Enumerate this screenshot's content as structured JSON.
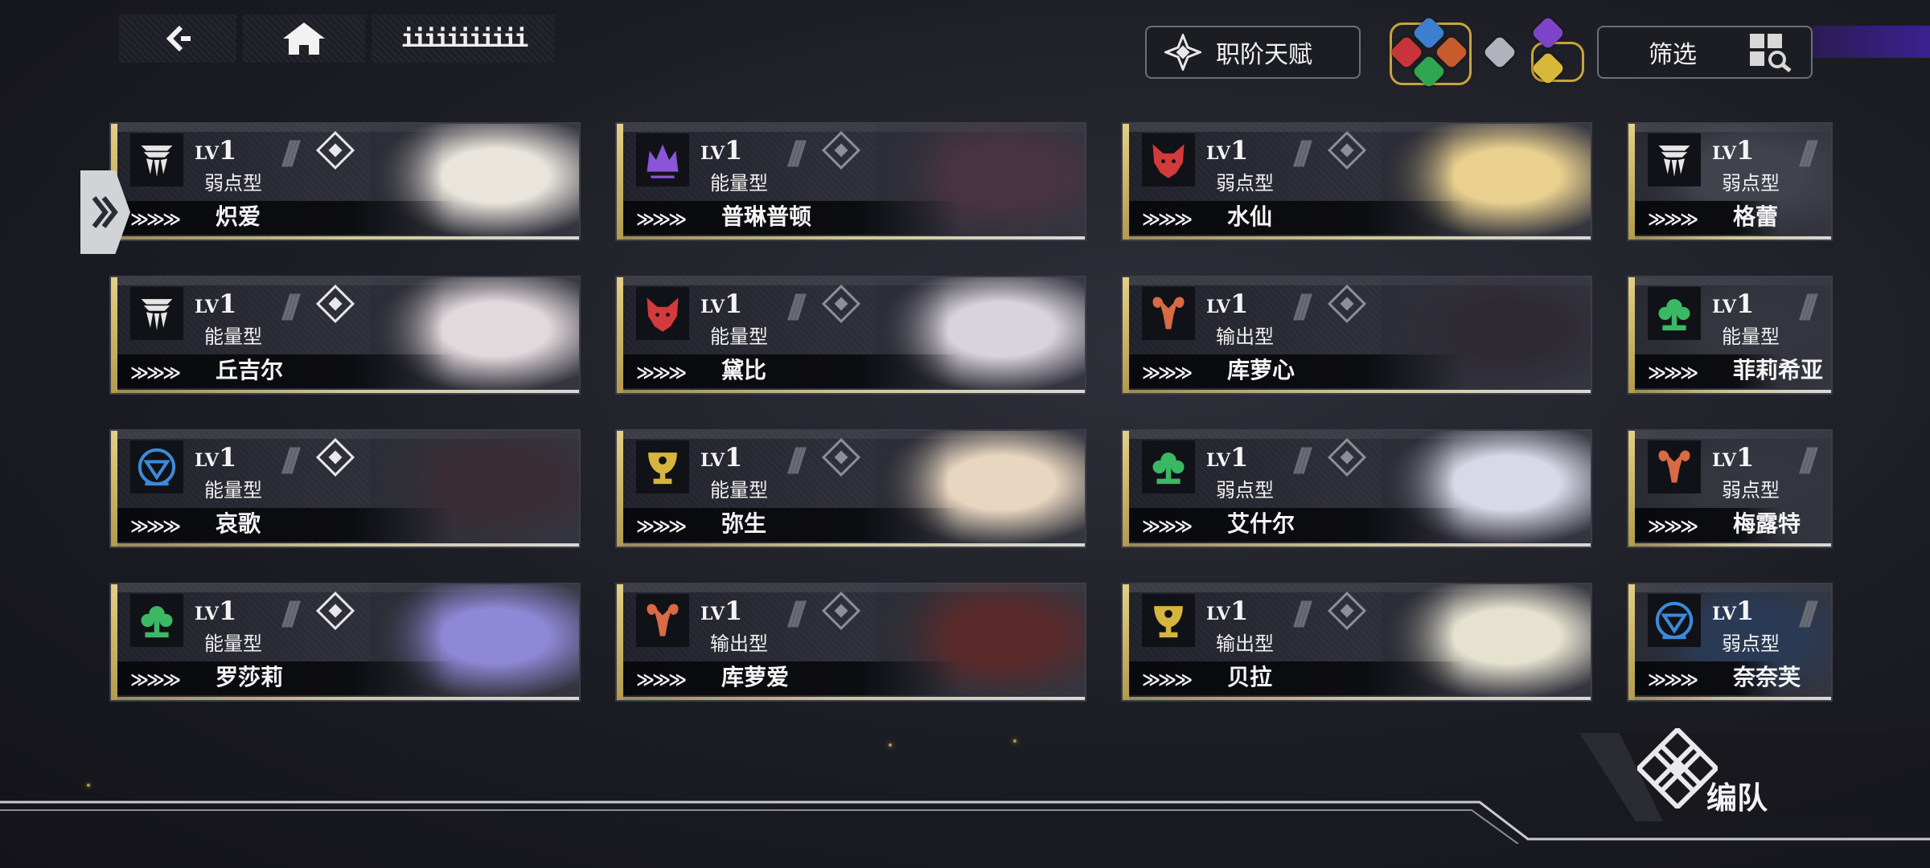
{
  "top_bar": {
    "title": "iiiiiiiiiii",
    "talent_label": "职阶天赋",
    "filter_label": "筛选"
  },
  "colors": {
    "gold_edge": "#d4bd6e",
    "purple_accent": "#3b2190",
    "gem_red": "#c9343a",
    "gem_blue": "#3c7fd0",
    "gem_orange": "#c85b2d",
    "gem_green": "#2fa64f",
    "gem_silver": "#b0b3bb",
    "gem_purple": "#7d44c8",
    "gem_gold": "#d8b83a"
  },
  "characters": [
    {
      "level_prefix": "LV",
      "level": "1",
      "type": "弱点型",
      "name": "炽爱",
      "class_icon": "angel-wing-icon",
      "class_color": "#e6e6e6",
      "diamond": "bright",
      "portrait": "#e9e4dc"
    },
    {
      "level_prefix": "LV",
      "level": "1",
      "type": "能量型",
      "name": "普琳普顿",
      "class_icon": "crown-icon",
      "class_color": "#8a55d8",
      "diamond": "dim",
      "portrait": "#4a3340"
    },
    {
      "level_prefix": "LV",
      "level": "1",
      "type": "弱点型",
      "name": "水仙",
      "class_icon": "wolf-icon",
      "class_color": "#d23a3c",
      "diamond": "dim",
      "portrait": "#e9d08f"
    },
    {
      "level_prefix": "LV",
      "level": "1",
      "type": "弱点型",
      "name": "格蕾",
      "class_icon": "angel-wing-icon",
      "class_color": "#e6e6e6",
      "diamond": "none",
      "portrait": "#40424c"
    },
    {
      "level_prefix": "LV",
      "level": "1",
      "type": "能量型",
      "name": "丘吉尔",
      "class_icon": "angel-wing-icon",
      "class_color": "#e6e6e6",
      "diamond": "bright",
      "portrait": "#e2d9dc"
    },
    {
      "level_prefix": "LV",
      "level": "1",
      "type": "能量型",
      "name": "黛比",
      "class_icon": "wolf-icon",
      "class_color": "#d23a3c",
      "diamond": "dim",
      "portrait": "#d9d3dc"
    },
    {
      "level_prefix": "LV",
      "level": "1",
      "type": "输出型",
      "name": "库萝心",
      "class_icon": "ram-icon",
      "class_color": "#d86a44",
      "diamond": "dim",
      "portrait": "#2e2a33"
    },
    {
      "level_prefix": "LV",
      "level": "1",
      "type": "能量型",
      "name": "菲莉希亚",
      "class_icon": "tree-icon",
      "class_color": "#3bb864",
      "diamond": "none",
      "portrait": "#33353f"
    },
    {
      "level_prefix": "LV",
      "level": "1",
      "type": "能量型",
      "name": "哀歌",
      "class_icon": "shield-heart-icon",
      "class_color": "#3c8ad8",
      "diamond": "bright",
      "portrait": "#3a2d35"
    },
    {
      "level_prefix": "LV",
      "level": "1",
      "type": "能量型",
      "name": "弥生",
      "class_icon": "chalice-icon",
      "class_color": "#d6b440",
      "diamond": "dim",
      "portrait": "#e8d6c0"
    },
    {
      "level_prefix": "LV",
      "level": "1",
      "type": "弱点型",
      "name": "艾什尔",
      "class_icon": "tree-icon",
      "class_color": "#3bb864",
      "diamond": "dim",
      "portrait": "#d8d8e6"
    },
    {
      "level_prefix": "LV",
      "level": "1",
      "type": "弱点型",
      "name": "梅露特",
      "class_icon": "ram-icon",
      "class_color": "#d86a44",
      "diamond": "none",
      "portrait": "#33353f"
    },
    {
      "level_prefix": "LV",
      "level": "1",
      "type": "能量型",
      "name": "罗莎莉",
      "class_icon": "tree-icon",
      "class_color": "#3bb864",
      "diamond": "bright",
      "portrait": "#8f88d6"
    },
    {
      "level_prefix": "LV",
      "level": "1",
      "type": "输出型",
      "name": "库萝爱",
      "class_icon": "ram-icon",
      "class_color": "#d86a44",
      "diamond": "dim",
      "portrait": "#5a2a2a"
    },
    {
      "level_prefix": "LV",
      "level": "1",
      "type": "输出型",
      "name": "贝拉",
      "class_icon": "chalice-icon",
      "class_color": "#d6b440",
      "diamond": "dim",
      "portrait": "#e6e2d0"
    },
    {
      "level_prefix": "LV",
      "level": "1",
      "type": "弱点型",
      "name": "奈奈芙",
      "class_icon": "shield-heart-icon",
      "class_color": "#3c8ad8",
      "diamond": "none",
      "portrait": "#2a3a55"
    }
  ],
  "formation": {
    "label": "编队"
  }
}
